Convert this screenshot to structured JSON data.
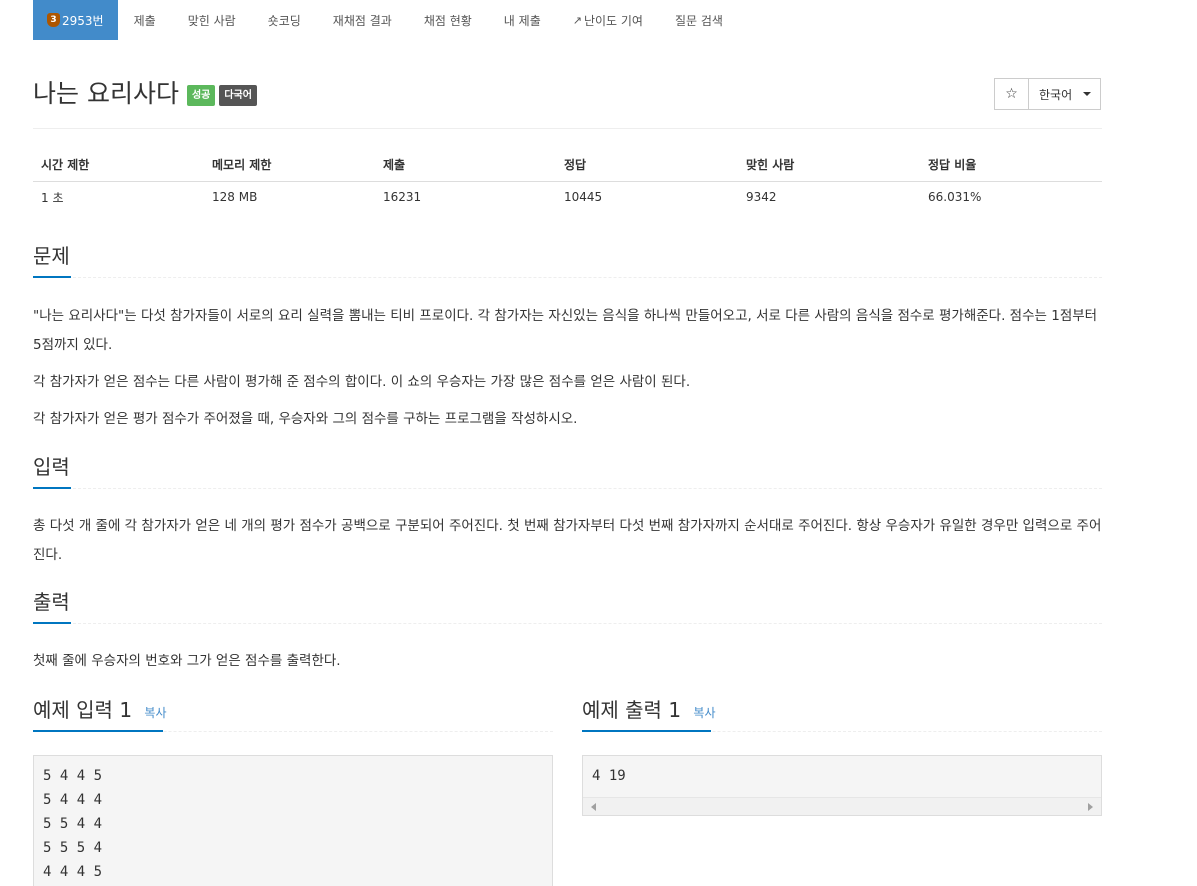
{
  "nav": {
    "problem_id": "2953번",
    "tier": "3",
    "items": [
      "제출",
      "맞힌 사람",
      "숏코딩",
      "재채점 결과",
      "채점 현황",
      "내 제출",
      "난이도 기여",
      "질문 검색"
    ]
  },
  "problem": {
    "title": "나는 요리사다",
    "label_success": "성공",
    "label_multi": "다국어"
  },
  "controls": {
    "star": "☆",
    "language": "한국어"
  },
  "info_table": {
    "headers": [
      "시간 제한",
      "메모리 제한",
      "제출",
      "정답",
      "맞힌 사람",
      "정답 비율"
    ],
    "values": [
      "1 초",
      "128 MB",
      "16231",
      "10445",
      "9342",
      "66.031%"
    ]
  },
  "sections": {
    "description_title": "문제",
    "description": [
      "\"나는 요리사다\"는 다섯 참가자들이 서로의 요리 실력을 뽐내는 티비 프로이다. 각 참가자는 자신있는 음식을 하나씩 만들어오고, 서로 다른 사람의 음식을 점수로 평가해준다. 점수는 1점부터 5점까지 있다.",
      "각 참가자가 얻은 점수는 다른 사람이 평가해 준 점수의 합이다. 이 쇼의 우승자는 가장 많은 점수를 얻은 사람이 된다.",
      "각 참가자가 얻은 평가 점수가 주어졌을 때, 우승자와 그의 점수를 구하는 프로그램을 작성하시오."
    ],
    "input_title": "입력",
    "input": "총 다섯 개 줄에 각 참가자가 얻은 네 개의 평가 점수가 공백으로 구분되어 주어진다. 첫 번째 참가자부터 다섯 번째 참가자까지 순서대로 주어진다. 항상 우승자가 유일한 경우만 입력으로 주어진다.",
    "output_title": "출력",
    "output": "첫째 줄에 우승자의 번호와 그가 얻은 점수를 출력한다."
  },
  "samples": {
    "input_title": "예제 입력 1",
    "output_title": "예제 출력 1",
    "copy_label": "복사",
    "input_lines": [
      "5 4 4 5",
      "5 4 4 4",
      "5 5 4 4",
      "5 5 5 4",
      "4 4 4 5"
    ],
    "output_lines": [
      "4 19"
    ]
  }
}
